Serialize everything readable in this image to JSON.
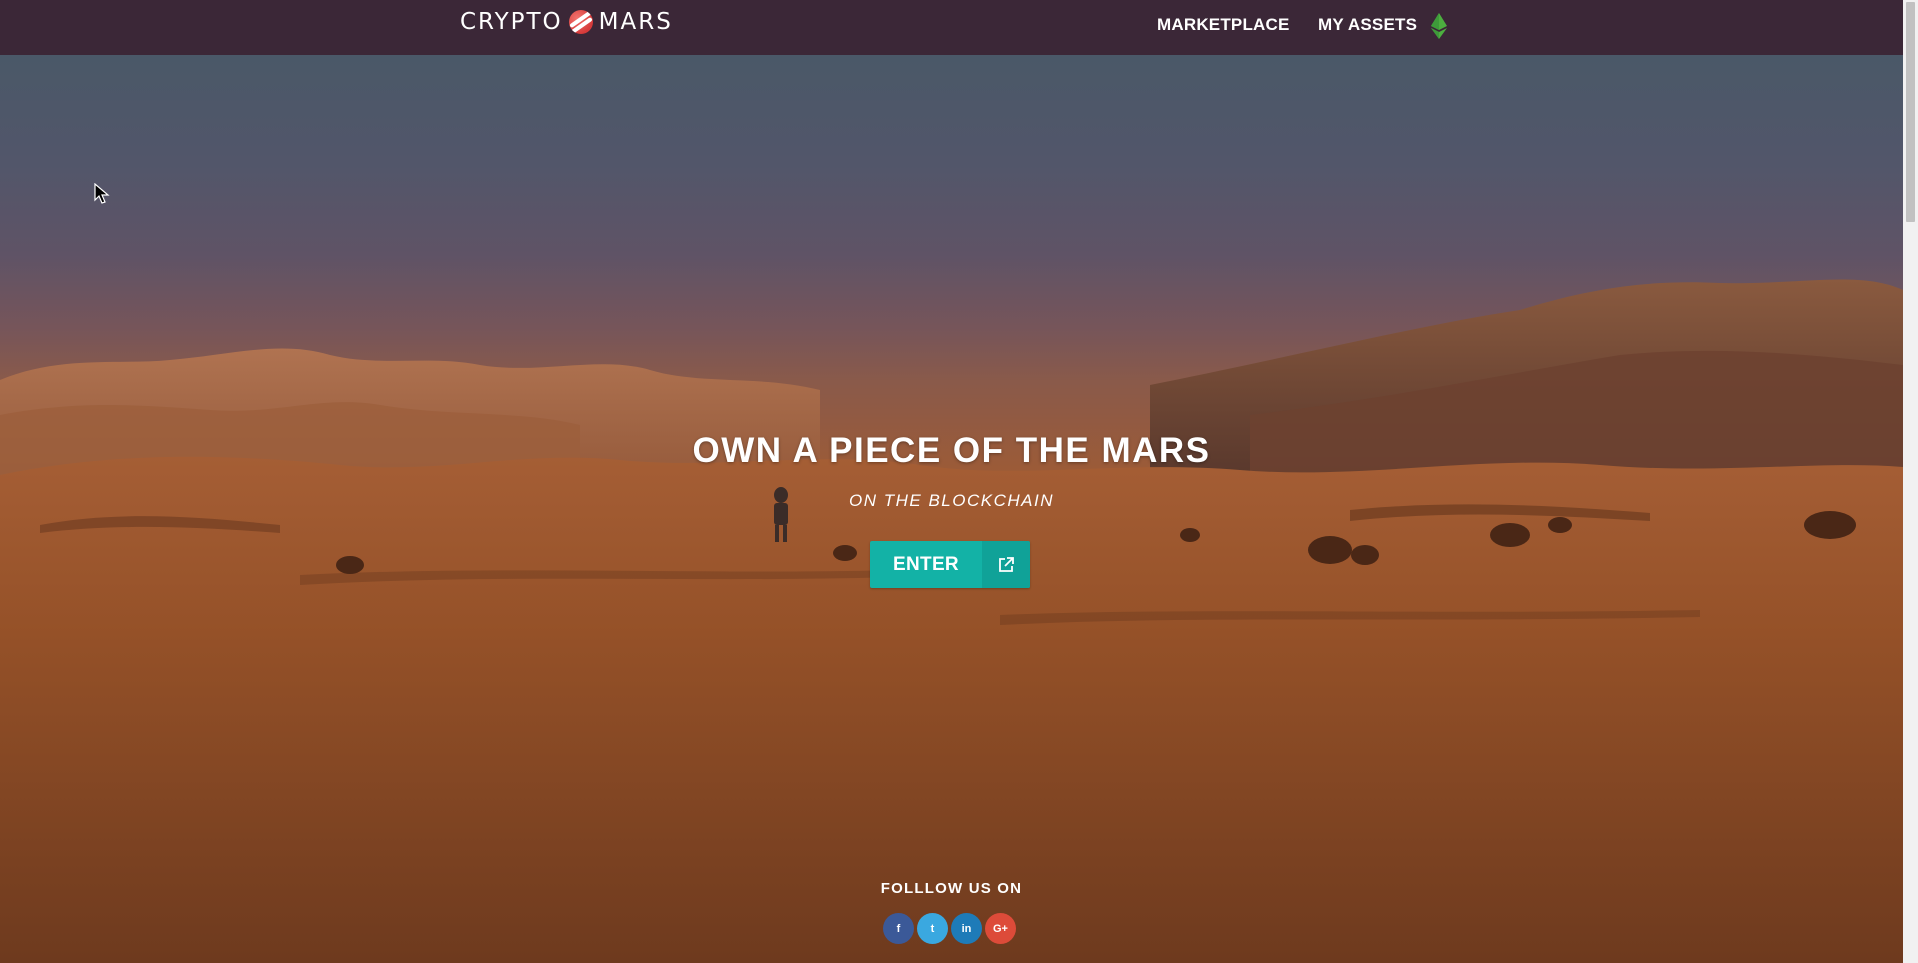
{
  "header": {
    "logo_left": "CRYPTO",
    "logo_right": "MARS",
    "nav": [
      {
        "label": "MARKETPLACE"
      },
      {
        "label": "MY ASSETS"
      }
    ],
    "wallet_icon": "ethereum-icon"
  },
  "hero": {
    "title": "OWN A PIECE OF THE MARS",
    "subtitle": "ON THE BLOCKCHAIN",
    "enter_label": "ENTER",
    "enter_icon": "external-link-icon"
  },
  "social": {
    "label": "FOLLLOW US ON",
    "buttons": [
      {
        "icon": "facebook-icon",
        "glyph": "f",
        "color": "#3b5998"
      },
      {
        "icon": "twitter-icon",
        "glyph": "t",
        "color": "#3aa8e0"
      },
      {
        "icon": "linkedin-icon",
        "glyph": "in",
        "color": "#1e7bb8"
      },
      {
        "icon": "google-plus-icon",
        "glyph": "G+",
        "color": "#dd4b39"
      }
    ]
  },
  "colors": {
    "navbar": "#3b2737",
    "accent": "#13b2a6",
    "ethereum": "#3e9b3a"
  }
}
